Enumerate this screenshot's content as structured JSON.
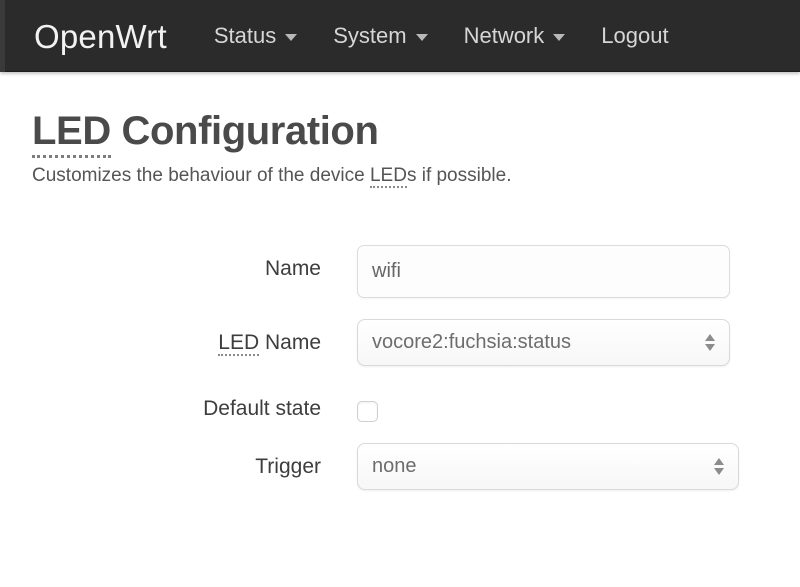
{
  "navbar": {
    "brand": "OpenWrt",
    "items": [
      {
        "label": "Status",
        "has_caret": true
      },
      {
        "label": "System",
        "has_caret": true
      },
      {
        "label": "Network",
        "has_caret": true
      },
      {
        "label": "Logout",
        "has_caret": false
      }
    ]
  },
  "page": {
    "title_abbr": "LED",
    "title_rest": " Configuration",
    "description_before": "Customizes the behaviour of the device ",
    "description_abbr": "LED",
    "description_after": "s if possible."
  },
  "form": {
    "name": {
      "label": "Name",
      "value": "wifi",
      "placeholder": ""
    },
    "led_name": {
      "label_abbr": "LED",
      "label_rest": " Name",
      "value": "vocore2:fuchsia:status"
    },
    "default_state": {
      "label": "Default state",
      "checked": false
    },
    "trigger": {
      "label": "Trigger",
      "value": "none"
    }
  },
  "colors": {
    "navbar_bg": "#2b2b2b",
    "navbar_text": "#d6d6d6",
    "brand_text": "#f2f2f2",
    "page_bg": "#ffffff",
    "title_text": "#4a4a4a",
    "label_text": "#3d3d3d",
    "input_text": "#666666",
    "input_border": "#dcdcdc"
  }
}
